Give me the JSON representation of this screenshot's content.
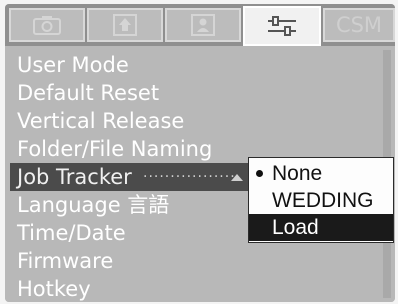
{
  "tabs": [
    {
      "name": "camera-icon"
    },
    {
      "name": "playback-icon"
    },
    {
      "name": "person-icon"
    },
    {
      "name": "wrench-icon",
      "active": true
    },
    {
      "label": "CSM"
    }
  ],
  "menu": {
    "items": [
      {
        "label": "User Mode"
      },
      {
        "label": "Default Reset"
      },
      {
        "label": "Vertical Release"
      },
      {
        "label": "Folder/File Naming"
      },
      {
        "label": "Job Tracker",
        "selected": true
      },
      {
        "label": "Language 言語"
      },
      {
        "label": "Time/Date"
      },
      {
        "label": "Firmware"
      },
      {
        "label": "Hotkey"
      }
    ]
  },
  "popup": {
    "options": [
      {
        "label": "None",
        "current": true
      },
      {
        "label": "WEDDING"
      },
      {
        "label": "Load",
        "highlighted": true
      }
    ]
  },
  "colors": {
    "tab_bar": "#8f8f8f",
    "menu_bg": "#b8b8b8",
    "selection": "#4b4b4b",
    "popup_highlight": "#1a1a1a"
  }
}
